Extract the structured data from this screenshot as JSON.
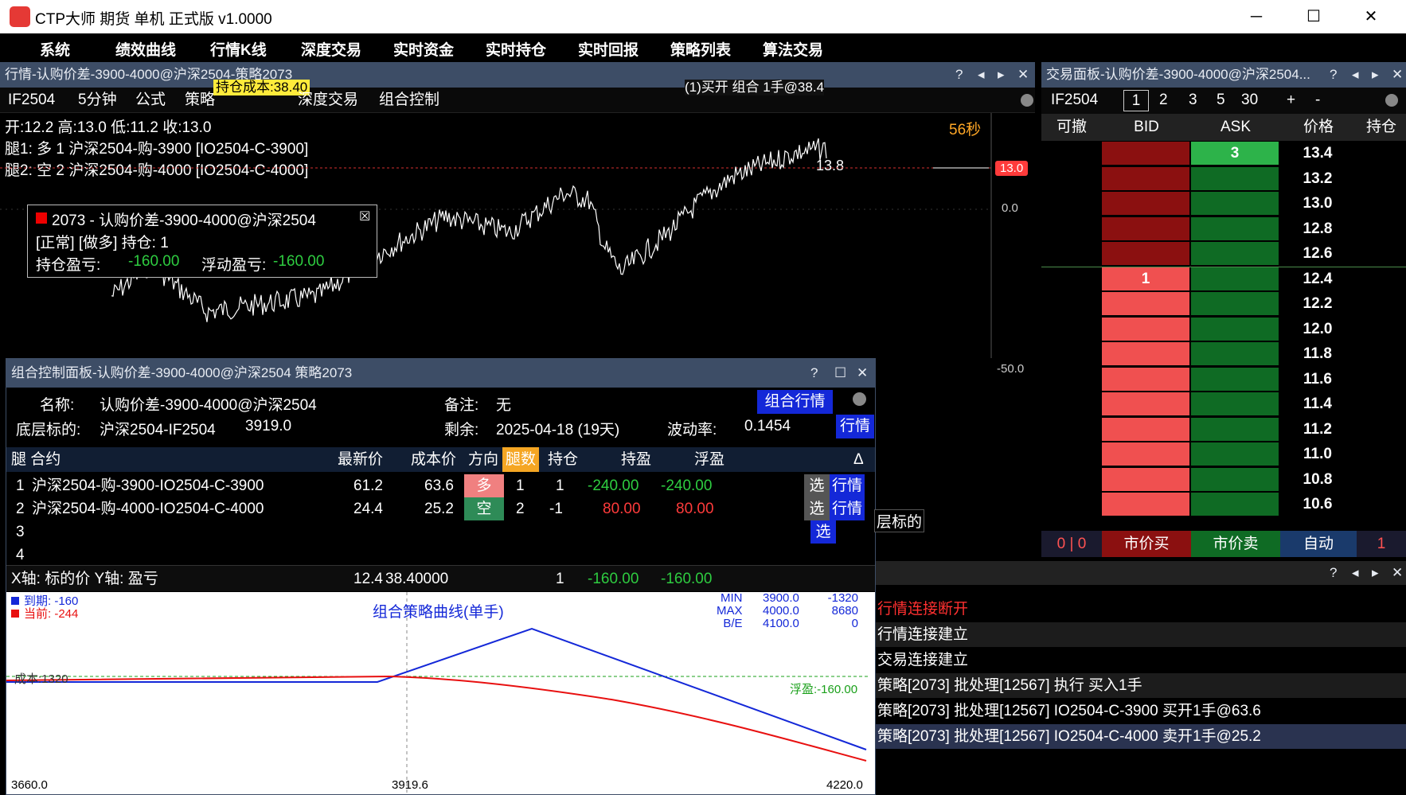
{
  "app": {
    "title": "CTP大师 期货 单机 正式版 v1.0000"
  },
  "menu": [
    "系统",
    "绩效曲线",
    "行情K线",
    "深度交易",
    "实时资金",
    "实时持仓",
    "实时回报",
    "策略列表",
    "算法交易"
  ],
  "chart": {
    "title": "行情-认购价差-3900-4000@沪深2504-策略2073",
    "toolbar": {
      "symbol": "IF2504",
      "period": "5分钟",
      "formula": "公式",
      "strategy": "策略",
      "overlay_cost": "持仓成本:38.40",
      "depth_trade": "深度交易",
      "combo": "组合控制",
      "order_msg": "(1)买开 组合 1手@38.4"
    },
    "ohlc": "开:12.2 高:13.0 低:11.2 收:13.0",
    "leg1": "腿1: 多 1 沪深2504-购-3900 [IO2504-C-3900]",
    "leg2": "腿2: 空 2 沪深2504-购-4000 [IO2504-C-4000]",
    "countdown": "56秒",
    "last_label": "13.8",
    "price_tag": "13.0",
    "axis": [
      "0.0",
      "-50.0"
    ],
    "info": {
      "name": "2073 - 认购价差-3900-4000@沪深2504",
      "status": "[正常] [做多] 持仓: 1",
      "pnl_label": "持仓盈亏:",
      "pnl": "-160.00",
      "float_label": "浮动盈亏:",
      "float": "-160.00"
    },
    "underlying_tag": "层标的"
  },
  "trade": {
    "title": "交易面板-认购价差-3900-4000@沪深2504...",
    "symbol": "IF2504",
    "qty": [
      "1",
      "2",
      "3",
      "5",
      "30"
    ],
    "plus": "+",
    "minus": "-",
    "headers": [
      "可撤",
      "BID",
      "ASK",
      "价格",
      "持仓"
    ],
    "rows": [
      {
        "price": "13.4",
        "bid": "",
        "ask": "3"
      },
      {
        "price": "13.2",
        "bid": "",
        "ask": ""
      },
      {
        "price": "13.0",
        "bid": "",
        "ask": ""
      },
      {
        "price": "12.8",
        "bid": "",
        "ask": ""
      },
      {
        "price": "12.6",
        "bid": "",
        "ask": ""
      },
      {
        "price": "12.4",
        "bid": "1",
        "ask": ""
      },
      {
        "price": "12.2",
        "bid": "",
        "ask": ""
      },
      {
        "price": "12.0",
        "bid": "",
        "ask": ""
      },
      {
        "price": "11.8",
        "bid": "",
        "ask": ""
      },
      {
        "price": "11.6",
        "bid": "",
        "ask": ""
      },
      {
        "price": "11.4",
        "bid": "",
        "ask": ""
      },
      {
        "price": "11.2",
        "bid": "",
        "ask": ""
      },
      {
        "price": "11.0",
        "bid": "",
        "ask": ""
      },
      {
        "price": "10.8",
        "bid": "",
        "ask": ""
      },
      {
        "price": "10.6",
        "bid": "",
        "ask": ""
      }
    ],
    "footer": {
      "cancel": "0",
      "cancel2": "0",
      "market_buy": "市价买",
      "market_sell": "市价卖",
      "auto": "自动",
      "pos": "1"
    }
  },
  "log": [
    "行情连接断开",
    "行情连接建立",
    "交易连接建立",
    "策略[2073] 批处理[12567] 执行 买入1手",
    "策略[2073] 批处理[12567] IO2504-C-3900 买开1手@63.6",
    "策略[2073] 批处理[12567] IO2504-C-4000 卖开1手@25.2"
  ],
  "combo": {
    "title": "组合控制面板-认购价差-3900-4000@沪深2504 策略2073",
    "name_label": "名称:",
    "name": "认购价差-3900-4000@沪深2504",
    "note_label": "备注:",
    "note": "无",
    "quote_btn": "组合行情",
    "base_label": "底层标的:",
    "base": "沪深2504-IF2504",
    "base_price": "3919.0",
    "remain_label": "剩余:",
    "remain": "2025-04-18 (19天)",
    "vol_label": "波动率:",
    "vol": "0.1454",
    "quote_btn2": "行情",
    "headers": {
      "leg": "腿 合约",
      "last": "最新价",
      "cost": "成本价",
      "dir": "方向",
      "legs": "腿数",
      "pos": "持仓",
      "hold_pnl": "持盈",
      "float_pnl": "浮盈",
      "delta": "Δ"
    },
    "rows": [
      {
        "idx": "1",
        "contract": "沪深2504-购-3900-IO2504-C-3900",
        "last": "61.2",
        "cost": "63.6",
        "dir": "多",
        "legs": "1",
        "pos": "1",
        "hold": "-240.00",
        "float": "-240.00"
      },
      {
        "idx": "2",
        "contract": "沪深2504-购-4000-IO2504-C-4000",
        "last": "24.4",
        "cost": "25.2",
        "dir": "空",
        "legs": "2",
        "pos": "-1",
        "hold": "80.00",
        "float": "80.00"
      },
      {
        "idx": "3"
      },
      {
        "idx": "4"
      }
    ],
    "sel": "选",
    "quote": "行情",
    "xy": {
      "axes": "X轴: 标的价   Y轴: 盈亏",
      "last": "12.4",
      "cost": "38.40000",
      "pos": "1",
      "hold": "-160.00",
      "float": "-160.00"
    },
    "payoff": {
      "title": "组合策略曲线(单手)",
      "expiry_label": "到期:",
      "expiry": "-160",
      "current_label": "当前:",
      "current": "-244",
      "min_label": "MIN",
      "min_x": "3900.0",
      "min_y": "-1320",
      "max_label": "MAX",
      "max_x": "4000.0",
      "max_y": "8680",
      "be_label": "B/E",
      "be_x": "4100.0",
      "be_y": "0",
      "cost_label": "成本:1320",
      "float_label": "浮盈:-160.00",
      "x_start": "3660.0",
      "x_mid": "3919.6",
      "x_end": "4220.0"
    }
  }
}
